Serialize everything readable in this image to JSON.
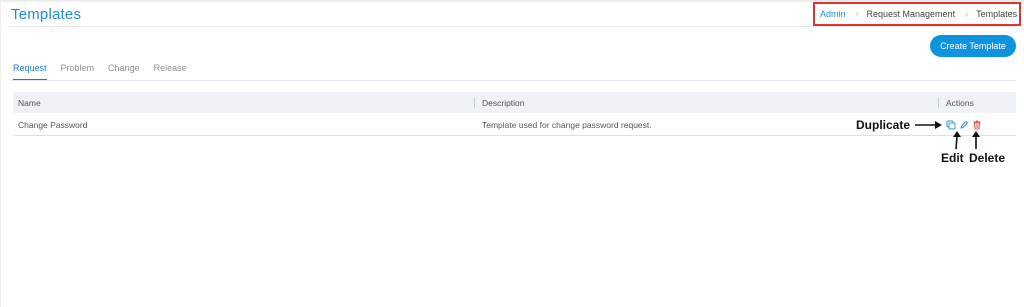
{
  "page": {
    "title": "Templates"
  },
  "breadcrumb": {
    "items": [
      "Admin",
      "Request Management",
      "Templates"
    ]
  },
  "create_button": {
    "label": "Create Template"
  },
  "tabs": [
    {
      "label": "Request",
      "active": true
    },
    {
      "label": "Problem",
      "active": false
    },
    {
      "label": "Change",
      "active": false
    },
    {
      "label": "Release",
      "active": false
    }
  ],
  "table": {
    "headers": {
      "name": "Name",
      "description": "Description",
      "actions": "Actions"
    },
    "rows": [
      {
        "name": "Change Password",
        "description": "Template used for change password request."
      }
    ]
  },
  "annotations": {
    "duplicate": "Duplicate",
    "edit": "Edit",
    "delete": "Delete"
  },
  "icons": {
    "duplicate": "copy-icon",
    "edit": "pencil-icon",
    "delete": "trash-icon"
  },
  "colors": {
    "accent": "#1e8fd6",
    "button": "#0e94de",
    "danger": "#e4322e",
    "header_bg": "#eef1f6"
  }
}
